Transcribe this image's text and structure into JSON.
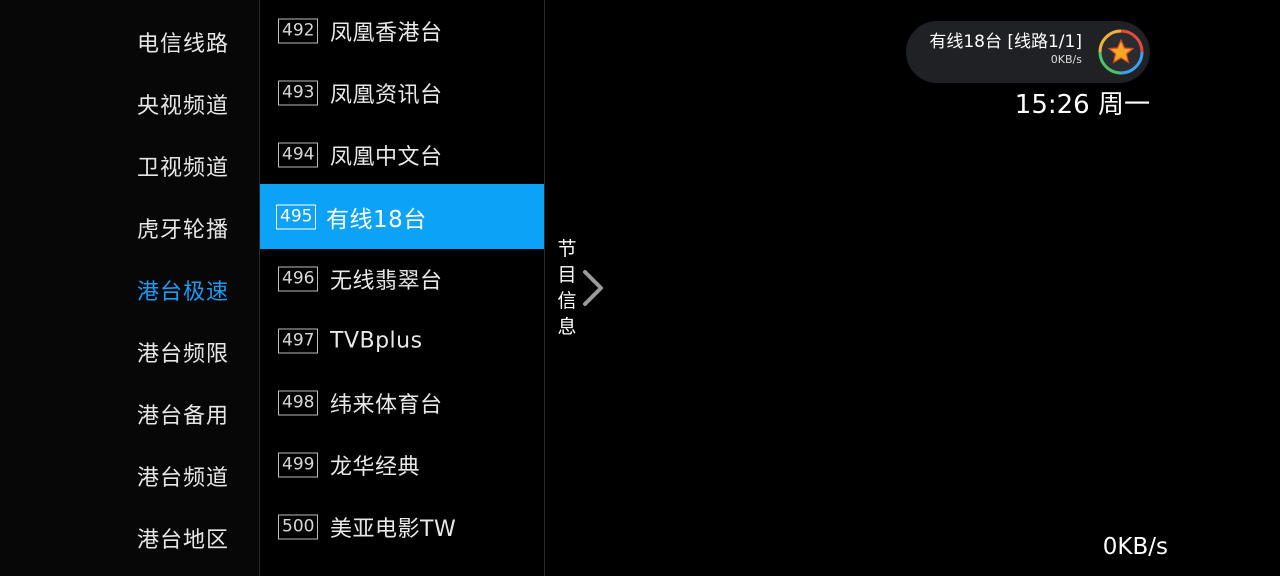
{
  "categories": [
    {
      "label": "电信线路",
      "active": false
    },
    {
      "label": "央视频道",
      "active": false
    },
    {
      "label": "卫视频道",
      "active": false
    },
    {
      "label": "虎牙轮播",
      "active": false
    },
    {
      "label": "港台极速",
      "active": true
    },
    {
      "label": "港台频限",
      "active": false
    },
    {
      "label": "港台备用",
      "active": false
    },
    {
      "label": "港台频道",
      "active": false
    },
    {
      "label": "港台地区",
      "active": false
    }
  ],
  "channels": [
    {
      "number": "492",
      "name": "凤凰香港台"
    },
    {
      "number": "493",
      "name": "凤凰资讯台"
    },
    {
      "number": "494",
      "name": "凤凰中文台"
    },
    {
      "number": "495",
      "name": "有线18台",
      "selected": true
    },
    {
      "number": "496",
      "name": "无线翡翠台"
    },
    {
      "number": "497",
      "name": "TVBplus"
    },
    {
      "number": "498",
      "name": "纬来体育台"
    },
    {
      "number": "499",
      "name": "龙华经典"
    },
    {
      "number": "500",
      "name": "美亚电影TW"
    }
  ],
  "epg_tab": {
    "label": [
      "节",
      "目",
      "信",
      "息"
    ],
    "icon": "chevron-right-icon"
  },
  "status": {
    "title": "有线18台 [线路1/1]",
    "speed": "0KB/s",
    "logo_icon": "star-logo-icon"
  },
  "clock": "15:26 周一",
  "net_speed": "0KB/s",
  "colors": {
    "accent": "#0ba2f8",
    "active_category": "#1a9cf5"
  }
}
